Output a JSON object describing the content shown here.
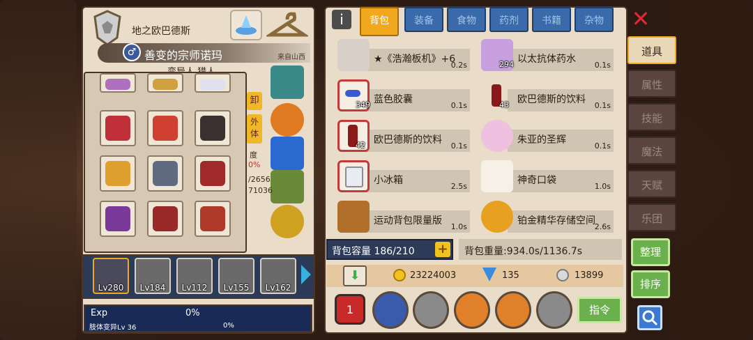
{
  "header": {
    "map_name": "地之欧巴德斯",
    "character_title": "善变的宗师诺玛",
    "origin": "来自山西",
    "class_line": "变异人 猎人"
  },
  "left_side_tabs": {
    "unequip": "卸",
    "appearance": "外体"
  },
  "stat_fragments": {
    "degree": "度",
    "percent": "0%",
    "val1": "/2656",
    "val2": "71036"
  },
  "characters": [
    {
      "level": "Lv280"
    },
    {
      "level": "Lv184"
    },
    {
      "level": "Lv112"
    },
    {
      "level": "Lv155"
    },
    {
      "level": "Lv162"
    }
  ],
  "exp": {
    "label": "Exp",
    "value": "0%",
    "sub_label": "肢体变异Lv 36",
    "sub_value": "0%"
  },
  "tabs": [
    "背包",
    "装备",
    "食物",
    "药剂",
    "书籍",
    "杂物"
  ],
  "inventory": [
    {
      "name": "★《浩瀚板机》+6",
      "weight": "0.2s",
      "count": ""
    },
    {
      "name": "以太抗体药水",
      "weight": "0.1s",
      "count": "294"
    },
    {
      "name": "蓝色胶囊",
      "weight": "0.1s",
      "count": "349"
    },
    {
      "name": "欧巴德斯的饮料",
      "weight": "0.1s",
      "count": "43"
    },
    {
      "name": "欧巴德斯的饮料",
      "weight": "0.1s",
      "count": "42"
    },
    {
      "name": "朱亚的圣辉",
      "weight": "0.1s",
      "count": ""
    },
    {
      "name": "小冰箱",
      "weight": "2.5s",
      "count": ""
    },
    {
      "name": "神奇口袋",
      "weight": "1.0s",
      "count": ""
    },
    {
      "name": "运动背包限量版",
      "weight": "1.0s",
      "count": ""
    },
    {
      "name": "铂金精华存储空间",
      "weight": "2.6s",
      "count": ""
    }
  ],
  "capacity": {
    "label": "背包容量 186/210",
    "plus": "+"
  },
  "weight": "背包重量:934.0s/1136.7s",
  "currency": {
    "gold": "23224003",
    "diamond": "135",
    "silver": "13899"
  },
  "command_label": "指令",
  "side_tabs": [
    "道具",
    "属性",
    "技能",
    "魔法",
    "天赋",
    "乐团"
  ],
  "actions": {
    "organize": "整理",
    "sort": "排序"
  },
  "colors": {
    "accent_orange": "#f2a81c",
    "tab_blue": "#3a6aaa",
    "panel_cream": "#e9dcc8",
    "green_button": "#6ab04c"
  }
}
